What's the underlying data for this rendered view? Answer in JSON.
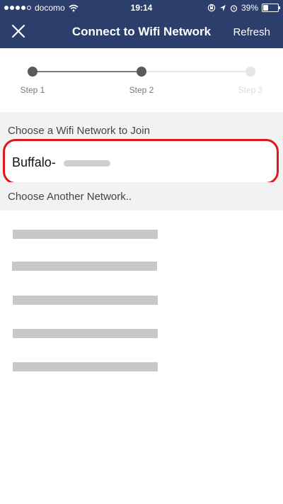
{
  "status_bar": {
    "carrier": "docomo",
    "time": "19:14",
    "battery_percent": "39%",
    "battery_level": 0.39,
    "icons": [
      "signal-dots-icon",
      "wifi-icon",
      "orientation-lock-icon",
      "location-icon",
      "alarm-icon",
      "battery-icon"
    ]
  },
  "nav": {
    "title": "Connect to Wifi Network",
    "refresh_label": "Refresh",
    "close_icon": "close-icon"
  },
  "stepper": {
    "steps": [
      {
        "label": "Step 1",
        "state": "done"
      },
      {
        "label": "Step 2",
        "state": "current"
      },
      {
        "label": "Step 3",
        "state": "inactive"
      }
    ]
  },
  "join_section": {
    "header": "Choose a Wifi Network to Join",
    "network_ssid": "Buffalo-"
  },
  "other_section": {
    "header": "Choose Another Network..",
    "networks_redacted_count": 5
  },
  "colors": {
    "nav_background": "#2c3e6b",
    "highlight_border": "#e0161c",
    "section_background": "#f2f2f2"
  }
}
